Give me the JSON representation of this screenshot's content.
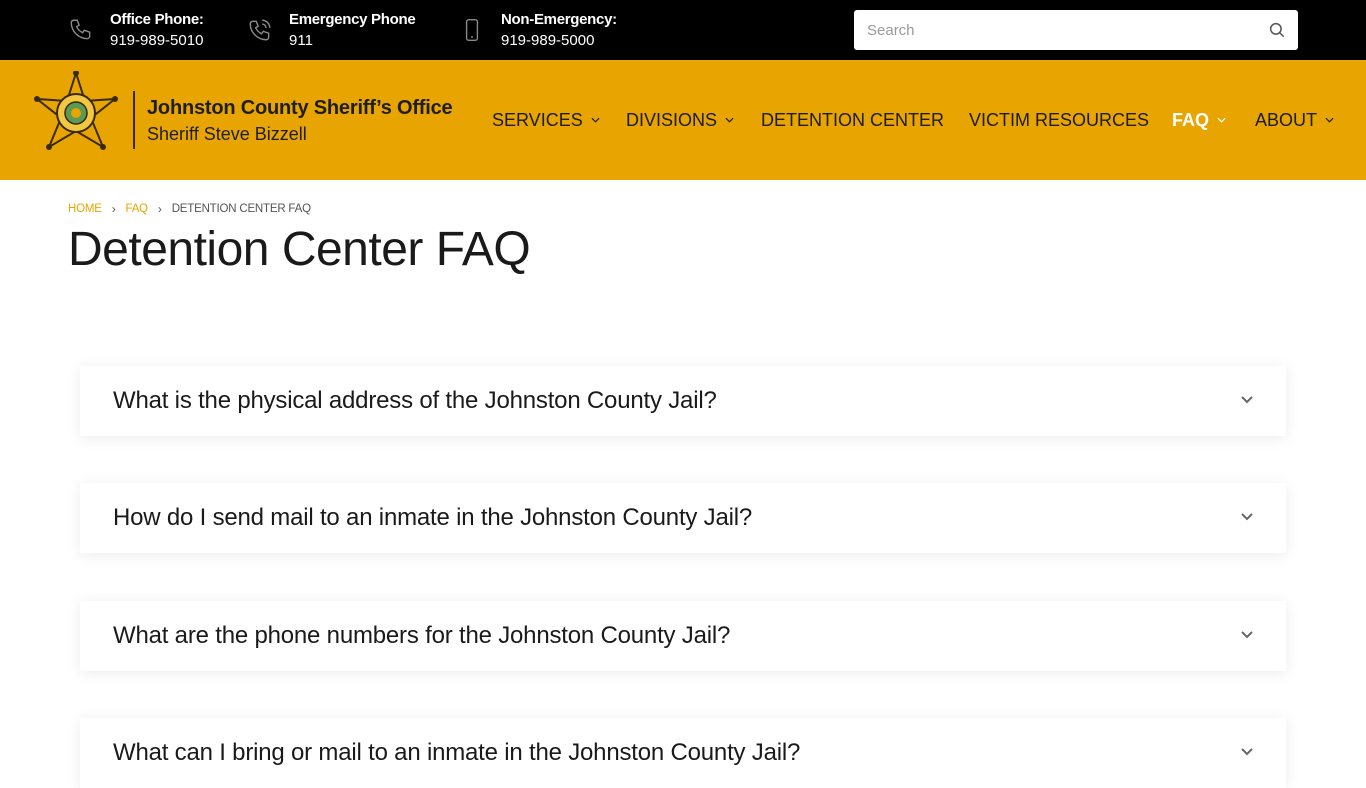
{
  "topbar": {
    "contacts": [
      {
        "label": "Office Phone:",
        "number": "919-989-5010",
        "icon": "phone-icon"
      },
      {
        "label": "Emergency Phone",
        "number": "911",
        "icon": "phone-ringing-icon"
      },
      {
        "label": "Non-Emergency:",
        "number": "919-989-5000",
        "icon": "mobile-phone-icon"
      }
    ],
    "search": {
      "placeholder": "Search",
      "value": ""
    }
  },
  "header": {
    "brand_title": "Johnston County Sheriff’s Office",
    "brand_subtitle": "Sheriff Steve Bizzell",
    "background": "#e8a400"
  },
  "nav": {
    "items": [
      {
        "label": "SERVICES",
        "has_dropdown": true,
        "active": false
      },
      {
        "label": "DIVISIONS",
        "has_dropdown": true,
        "active": false
      },
      {
        "label": "DETENTION CENTER",
        "has_dropdown": false,
        "active": false
      },
      {
        "label": "VICTIM RESOURCES",
        "has_dropdown": false,
        "active": false
      },
      {
        "label": "FAQ",
        "has_dropdown": true,
        "active": true
      },
      {
        "label": "ABOUT",
        "has_dropdown": true,
        "active": false
      }
    ]
  },
  "breadcrumb": {
    "items": [
      "HOME",
      "FAQ"
    ],
    "current": "DETENTION CENTER FAQ"
  },
  "page": {
    "title": "Detention Center FAQ"
  },
  "faq": {
    "questions": [
      "What is the physical address of the Johnston County Jail?",
      "How do I send mail to an inmate in the Johnston County Jail?",
      "What are the phone numbers for the Johnston County Jail?",
      "What can I bring or mail to an inmate in the Johnston County Jail?"
    ]
  },
  "colors": {
    "accent": "#e8a400",
    "topbar": "#000000",
    "text": "#1a1a1a"
  }
}
